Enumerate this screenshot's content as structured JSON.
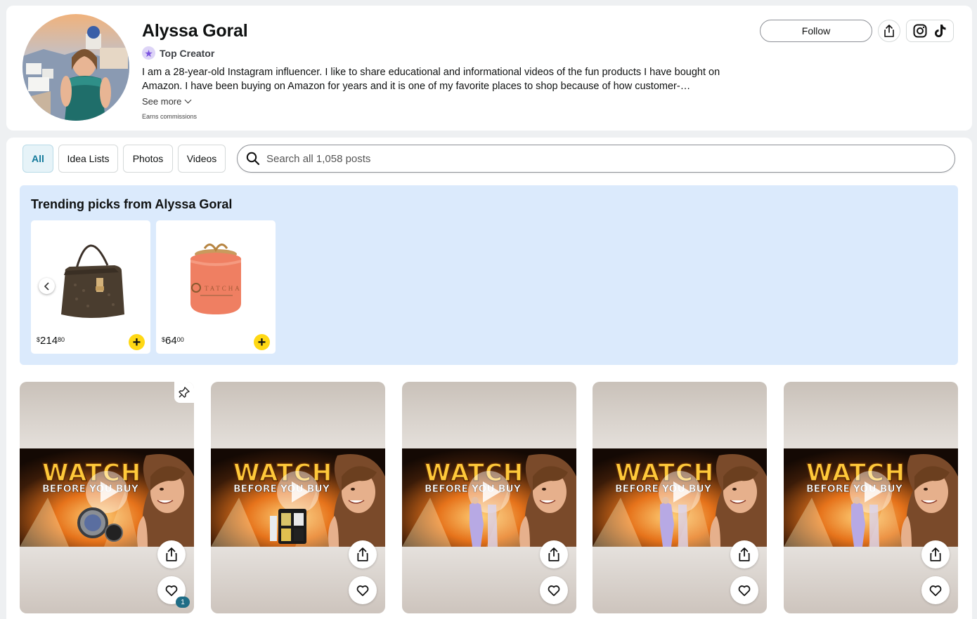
{
  "profile": {
    "name": "Alyssa Goral",
    "badge": "Top Creator",
    "bio": "I am a 28-year-old Instagram influencer. I like to share educational and informational videos of the fun products I have bought on Amazon. I have been buying on Amazon for years and it is one of my favorite places to shop because of how customer-…",
    "see_more": "See more",
    "commission_note": "Earns commissions",
    "follow_label": "Follow",
    "social_icons": [
      "instagram-icon",
      "tiktok-icon"
    ]
  },
  "filters": [
    "All",
    "Idea Lists",
    "Photos",
    "Videos"
  ],
  "search": {
    "placeholder": "Search all 1,058 posts"
  },
  "trending": {
    "title": "Trending picks from Alyssa Goral",
    "products": [
      {
        "name": "handbag",
        "price_currency": "$",
        "price_whole": "214",
        "price_fraction": "80"
      },
      {
        "name": "moisture-cream-jar",
        "price_currency": "$",
        "price_whole": "64",
        "price_fraction": "00",
        "brand_text": "TATCHA"
      }
    ]
  },
  "posts": [
    {
      "headline1": "WATCH",
      "headline2": "BEFORE YOU BUY",
      "product": "smartwatch",
      "pinned": true,
      "like_count": "1"
    },
    {
      "headline1": "WATCH",
      "headline2": "BEFORE YOU BUY",
      "product": "pill-organizer",
      "pinned": false,
      "like_count": ""
    },
    {
      "headline1": "WATCH",
      "headline2": "BEFORE YOU BUY",
      "product": "scrubs",
      "pinned": false,
      "like_count": ""
    },
    {
      "headline1": "WATCH",
      "headline2": "BEFORE YOU BUY",
      "product": "scrubs",
      "pinned": false,
      "like_count": ""
    },
    {
      "headline1": "WATCH",
      "headline2": "BEFORE YOU BUY",
      "product": "scrubs",
      "pinned": false,
      "like_count": ""
    }
  ],
  "colors": {
    "accent_blue": "#137a9b",
    "trending_bg": "#dbeafc",
    "add_yellow": "#ffd814",
    "badge_purple": "#7b52e0"
  }
}
